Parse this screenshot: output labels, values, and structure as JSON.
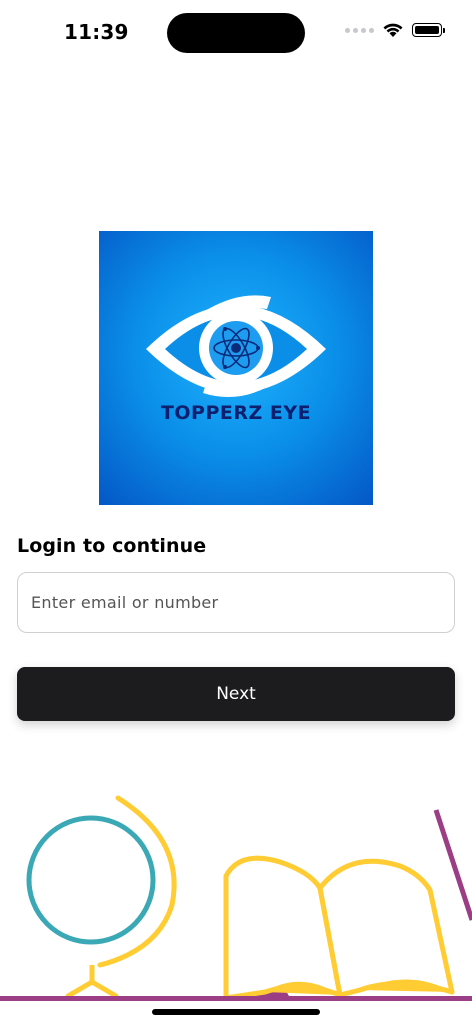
{
  "status_bar": {
    "time": "11:39",
    "icons": [
      "cellular-signal-icon",
      "wifi-icon",
      "battery-icon"
    ]
  },
  "logo": {
    "text": "TOPPERZ EYE",
    "icon": "atom-eye-logo",
    "colors": {
      "background_center": "#1fb3ff",
      "background_edge": "#0457c6",
      "text": "#0d1f6e"
    }
  },
  "login": {
    "title": "Login to continue",
    "input_placeholder": "Enter email or number",
    "input_value": "",
    "next_label": "Next"
  },
  "illustration": {
    "items": [
      "globe-icon",
      "open-book-icon",
      "pencil-icon"
    ],
    "colors": {
      "globe": "#3aa8b5",
      "yellow": "#ffcc33",
      "purple": "#9b3e86"
    }
  },
  "theme": {
    "button_bg": "#1c1c1f",
    "button_text": "#ffffff",
    "input_border": "#cfcfd4"
  }
}
